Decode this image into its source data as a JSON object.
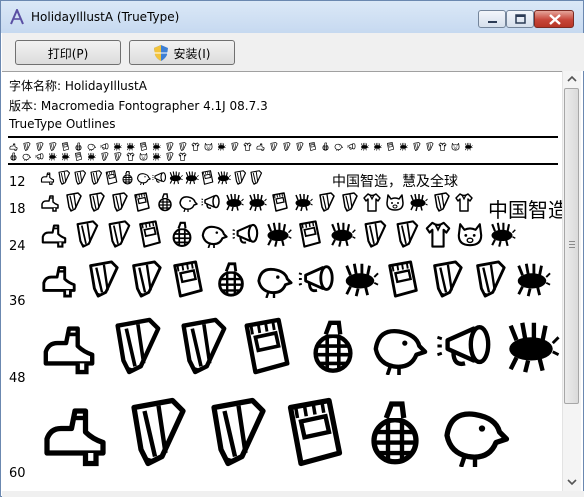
{
  "window": {
    "title": "HolidayIllustA (TrueType)"
  },
  "toolbar": {
    "print_label": "打印(P)",
    "install_label": "安装(I)"
  },
  "font_info": {
    "name_line": "字体名称: HolidayIllustA",
    "version_line": "版本: Macromedia Fontographer 4.1J 08.7.3",
    "type_line": "TrueType Outlines"
  },
  "sample": {
    "sizes": [
      "12",
      "18",
      "24",
      "36",
      "48",
      "60"
    ],
    "cjk_text_12": "中国智造，慧及全球",
    "cjk_text_18": "中国智造"
  },
  "glyphs": {
    "row12": [
      "shoe-glyph-icon",
      "pencil-glyph-icon",
      "pencil-glyph-icon",
      "pencil-glyph-icon",
      "notebook-glyph-icon",
      "grenade-glyph-icon",
      "bird-glyph-icon",
      "megaphone-glyph-icon",
      "bug-glyph-icon",
      "bug-glyph-icon",
      "notebook-glyph-icon",
      "bug-glyph-icon",
      "pencil-glyph-icon",
      "pencil-glyph-icon"
    ],
    "row18": [
      "shoe-glyph-icon",
      "pencil-glyph-icon",
      "pencil-glyph-icon",
      "pencil-glyph-icon",
      "notebook-glyph-icon",
      "grenade-glyph-icon",
      "bird-glyph-icon",
      "megaphone-glyph-icon",
      "bug-glyph-icon",
      "bug-glyph-icon",
      "notebook-glyph-icon",
      "bug-glyph-icon",
      "pencil-glyph-icon",
      "pencil-glyph-icon",
      "shirt-glyph-icon",
      "cat-glyph-icon",
      "bug-glyph-icon",
      "pencil-glyph-icon",
      "shirt-glyph-icon"
    ],
    "row24": [
      "shoe-glyph-icon",
      "pencil-glyph-icon",
      "pencil-glyph-icon",
      "notebook-glyph-icon",
      "grenade-glyph-icon",
      "bird-glyph-icon",
      "megaphone-glyph-icon",
      "bug-glyph-icon",
      "notebook-glyph-icon",
      "bug-glyph-icon",
      "pencil-glyph-icon",
      "pencil-glyph-icon",
      "shirt-glyph-icon",
      "cat-glyph-icon",
      "bug-glyph-icon"
    ],
    "row36": [
      "shoe-glyph-icon",
      "pencil-glyph-icon",
      "pencil-glyph-icon",
      "notebook-glyph-icon",
      "grenade-glyph-icon",
      "bird-glyph-icon",
      "megaphone-glyph-icon",
      "bug-glyph-icon",
      "notebook-glyph-icon",
      "pencil-glyph-icon",
      "pencil-glyph-icon",
      "bug-glyph-icon"
    ],
    "row48": [
      "shoe-glyph-icon",
      "pencil-glyph-icon",
      "pencil-glyph-icon",
      "notebook-glyph-icon",
      "grenade-glyph-icon",
      "bird-glyph-icon",
      "megaphone-glyph-icon",
      "bug-glyph-icon"
    ],
    "row60": [
      "shoe-glyph-icon",
      "pencil-glyph-icon",
      "pencil-glyph-icon",
      "notebook-glyph-icon",
      "grenade-glyph-icon",
      "bird-glyph-icon",
      "megaphone-glyph-icon"
    ]
  },
  "colors": {
    "title_bg": "#c6d9f0",
    "close_red": "#c7463a",
    "toolbar_bg": "#f0f0f0"
  }
}
